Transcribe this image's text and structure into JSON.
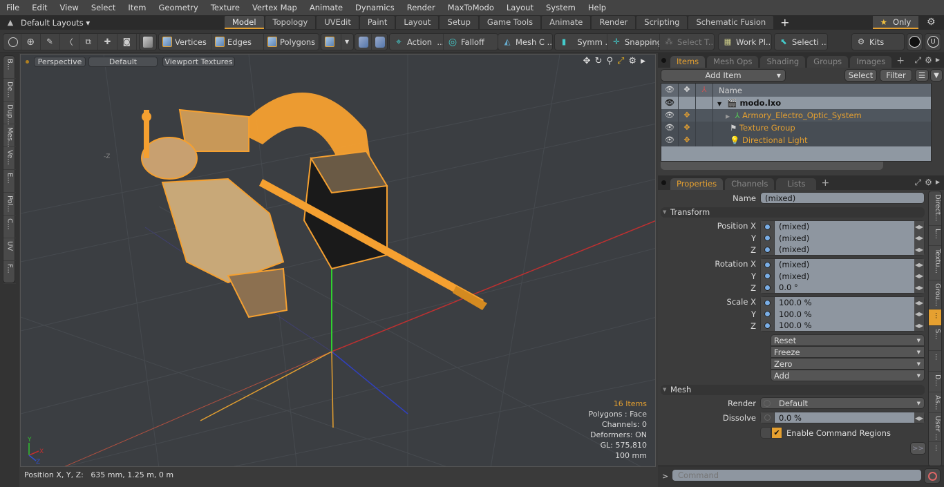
{
  "menu": [
    "File",
    "Edit",
    "View",
    "Select",
    "Item",
    "Geometry",
    "Texture",
    "Vertex Map",
    "Animate",
    "Dynamics",
    "Render",
    "MaxToModo",
    "Layout",
    "System",
    "Help"
  ],
  "layout_bar": {
    "layout_select": "Default Layouts ▾",
    "tabs": [
      "Model",
      "Topology",
      "UVEdit",
      "Paint",
      "Layout",
      "Setup",
      "Game Tools",
      "Animate",
      "Render",
      "Scripting",
      "Schematic Fusion"
    ],
    "active_tab": "Model",
    "add_tab": "+",
    "only_label": "Only"
  },
  "toolbar": {
    "vertices": "Vertices",
    "edges": "Edges",
    "polygons": "Polygons",
    "action": "Action",
    "action_more": "...",
    "falloff": "Falloff",
    "mesh_c": "Mesh C ...",
    "symm": "Symm ...",
    "snapping": "Snapping",
    "select_t": "Select T...",
    "work_pl": "Work Pl...",
    "selecti": "Selecti ...",
    "kits": "Kits"
  },
  "left_tabs": [
    "B...",
    "De...",
    "Dup...",
    "Mes...",
    "Ve...",
    "E...",
    "Pol...",
    "C...",
    "UV",
    "F..."
  ],
  "viewport": {
    "view_mode": "Perspective",
    "shading": "Default",
    "textures": "Viewport Textures",
    "axis_label_neg_z": "-Z",
    "stats": {
      "items": "16 Items",
      "polygons": "Polygons : Face",
      "channels": "Channels: 0",
      "deformers": "Deformers: ON",
      "gl": "GL: 575,810",
      "scale": "100 mm"
    },
    "gizmo": {
      "y": "Y",
      "x": "X",
      "z": "Z"
    },
    "colors": {
      "wire": "#f5a030",
      "bg": "#3b3e42",
      "x_axis": "#d03030",
      "y_axis": "#30d030",
      "z_axis": "#3040d0"
    }
  },
  "status": {
    "position_label": "Position X, Y, Z:",
    "position_value": "635 mm, 1.25 m, 0 m"
  },
  "items_panel": {
    "tabs": [
      "Items",
      "Mesh Ops",
      "Shading",
      "Groups",
      "Images"
    ],
    "active_tab": "Items",
    "add_item": "Add Item",
    "select": "Select",
    "filter": "Filter",
    "column_name": "Name",
    "rows": [
      {
        "name": "modo.lxo",
        "type": "scene"
      },
      {
        "name": "Armory_Electro_Optic_System",
        "type": "locator"
      },
      {
        "name": "Texture Group",
        "type": "texture"
      },
      {
        "name": "Directional Light",
        "type": "light"
      }
    ]
  },
  "properties_panel": {
    "tabs": [
      "Properties",
      "Channels",
      "Lists"
    ],
    "active_tab": "Properties",
    "name_label": "Name",
    "name_value": "(mixed)",
    "transform_section": "Transform",
    "position": {
      "label": "Position X",
      "x": "(mixed)",
      "y": "(mixed)",
      "z": "(mixed)"
    },
    "rotation": {
      "label": "Rotation X",
      "x": "(mixed)",
      "y": "(mixed)",
      "z": "0.0 °"
    },
    "scale": {
      "label": "Scale X",
      "x": "100.0 %",
      "y": "100.0 %",
      "z": "100.0 %"
    },
    "axis_y": "Y",
    "axis_z": "Z",
    "actions": [
      "Reset",
      "Freeze",
      "Zero",
      "Add"
    ],
    "mesh_section": "Mesh",
    "render_label": "Render",
    "render_value": "Default",
    "dissolve_label": "Dissolve",
    "dissolve_value": "0.0 %",
    "enable_cmd_regions": "Enable Command Regions",
    "more_btn": ">>",
    "right_tabs": [
      "Direct...",
      "L...",
      "Textu...",
      "Grou...",
      "...",
      "S...",
      "...",
      "D...",
      "As...",
      "User ...",
      "..."
    ]
  },
  "command": {
    "prompt": ">",
    "placeholder": "Command"
  }
}
